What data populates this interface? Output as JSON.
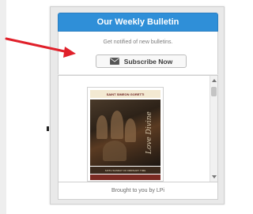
{
  "widget": {
    "title": "Our Weekly Bulletin",
    "subtitle": "Get notified of new bulletins.",
    "subscribe_label": "Subscribe Now",
    "subscribe_icon": "envelope-icon",
    "footer": "Brought to you by LPi"
  },
  "bulletin": {
    "parish_name": "SAINT SIMEON GORETTI",
    "cover_script": "Love Divine",
    "cover_band_text": "SIXTH SUNDAY OF ORDINARY TIME"
  },
  "annotation": {
    "arrow_color": "#e0202a"
  },
  "colors": {
    "title_bar": "#2f8fd8",
    "widget_bg": "#e9e9e9"
  }
}
